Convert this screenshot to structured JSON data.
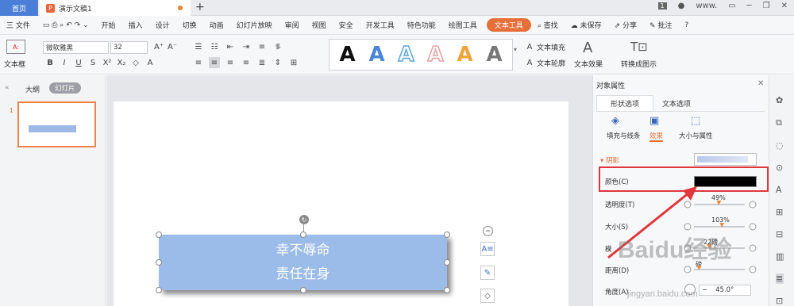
{
  "tabs": {
    "home": "首页",
    "doc": "演示文稿1",
    "add": "+",
    "page_badge": "1",
    "user": "www."
  },
  "menu": [
    "开始",
    "插入",
    "设计",
    "切换",
    "动画",
    "幻灯片放映",
    "审阅",
    "视图",
    "安全",
    "开发工具",
    "特色功能",
    "绘图工具",
    "文本工具"
  ],
  "menu_left": "三 文件",
  "menu_right": {
    "search": "查找",
    "save": "未保存",
    "share": "分享",
    "comment": "批注",
    "help": "?"
  },
  "ribbon": {
    "textbox_label": "文本框",
    "font_name": "微软雅黑",
    "font_size": "32",
    "fmt_bold": "B",
    "fmt_italic": "I",
    "fmt_underline": "U",
    "fmt_strike": "S",
    "fill_label": "文本填充",
    "outline_label": "文本轮廓",
    "effect_label": "文本效果",
    "convert_label": "转换成图示"
  },
  "style_colors": [
    "#111111",
    "#4a86d8",
    "#5aa4e0",
    "#e8a0a0",
    "#f0a43a",
    "#777777"
  ],
  "left": {
    "outline_tab": "大纲",
    "slides_tab": "幻灯片",
    "slide_num": "1"
  },
  "slide": {
    "line1": "幸不辱命",
    "line2": "责任在身"
  },
  "panel": {
    "title": "对象属性",
    "tab_shape": "形状选项",
    "tab_text": "文本选项",
    "sub_fill": "填充与线条",
    "sub_effect": "效果",
    "sub_size": "大小与属性",
    "section": "阴影",
    "color_label": "颜色(C)",
    "transparency_label": "透明度(T)",
    "transparency_value": "49%",
    "size_label": "大小(S)",
    "size_value": "103%",
    "blur_label": "模",
    "blur_value": "22磅",
    "distance_label": "距离(D)",
    "distance_value": "磅",
    "angle_label": "角度(A)",
    "angle_value": "45.0°"
  },
  "watermark": {
    "brand": "Baidu经验",
    "url": "jingyan.baidu.com"
  },
  "accent": "#e7703a",
  "highlight": "#e0373c"
}
